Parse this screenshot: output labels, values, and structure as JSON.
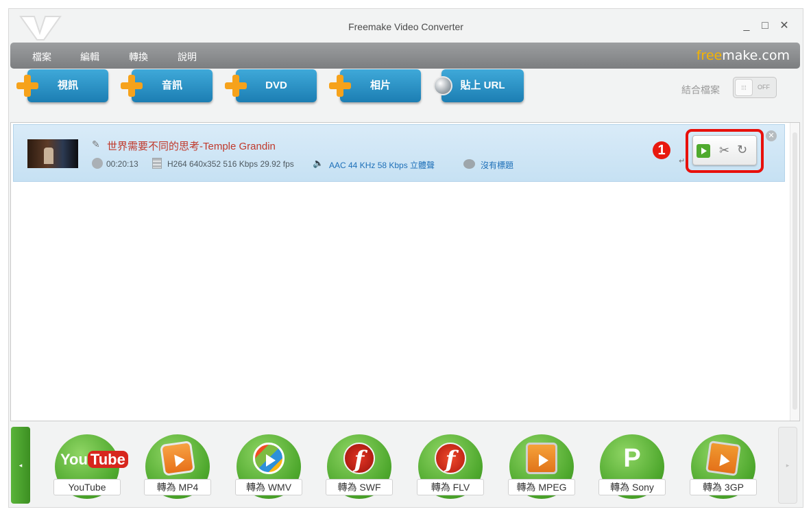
{
  "window": {
    "title": "Freemake Video Converter",
    "controls": {
      "minimize": "_",
      "maximize": "□",
      "close": "✕"
    }
  },
  "menu": {
    "items": [
      "檔案",
      "編輯",
      "轉換",
      "說明"
    ],
    "brand_accent": "free",
    "brand_rest": "make.com"
  },
  "toolbar": {
    "buttons": [
      "視訊",
      "音訊",
      "DVD",
      "相片",
      "貼上 URL"
    ],
    "merge_label": "結合檔案",
    "merge_state": "OFF"
  },
  "file": {
    "title": "世界需要不同的思考-Temple Grandin",
    "duration": "00:20:13",
    "video": "H264  640x352  516 Kbps  29.92 fps",
    "audio": "AAC  44 KHz  58 Kbps  立體聲",
    "subtitle": "沒有標題"
  },
  "callout": {
    "number": "1"
  },
  "presets": [
    "YouTube",
    "轉為 MP4",
    "轉為 WMV",
    "轉為 SWF",
    "轉為 FLV",
    "轉為 MPEG",
    "轉為 Sony",
    "轉為 3GP"
  ],
  "preset_icons": {
    "youtube_you": "You",
    "youtube_tube": "Tube",
    "swf_glyph": "f",
    "flv_glyph": "f",
    "sony_glyph": "P"
  },
  "colors": {
    "accent_blue": "#1c7eb3",
    "plus_orange": "#f6a21b",
    "preset_green": "#4ea82d",
    "title_red": "#c0392b",
    "highlight_red": "#e8100b"
  }
}
